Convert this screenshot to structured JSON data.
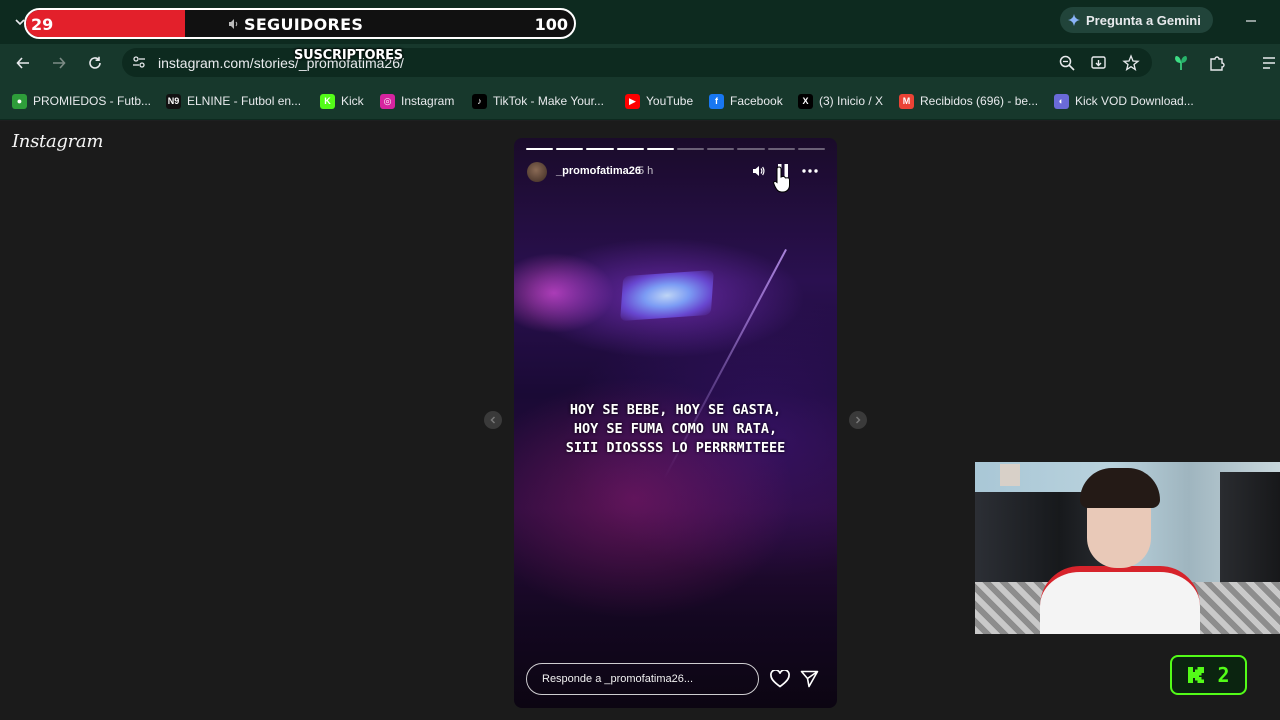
{
  "overlay": {
    "current": "29",
    "label": "SEGUIDORES",
    "target": "100",
    "progress": 0.29,
    "sublabel": "SUSCRIPTORES"
  },
  "browser": {
    "url": "instagram.com/stories/_promofatima26/",
    "gemini_label": "Pregunta a Gemini",
    "bookmarks": [
      {
        "label": "PROMIEDOS - Futb...",
        "icon": "promiedos-icon",
        "color": "#2e9d3a",
        "glyph": "●"
      },
      {
        "label": "ELNINE - Futbol en...",
        "icon": "elnine-icon",
        "color": "#111111",
        "glyph": "N9"
      },
      {
        "label": "Kick",
        "icon": "kick-icon",
        "color": "#53fc18",
        "glyph": "K"
      },
      {
        "label": "Instagram",
        "icon": "instagram-icon",
        "color": "#d6249f",
        "glyph": "◎"
      },
      {
        "label": "TikTok - Make Your...",
        "icon": "tiktok-icon",
        "color": "#000000",
        "glyph": "♪"
      },
      {
        "label": "YouTube",
        "icon": "youtube-icon",
        "color": "#ff0000",
        "glyph": "▶"
      },
      {
        "label": "Facebook",
        "icon": "facebook-icon",
        "color": "#1877f2",
        "glyph": "f"
      },
      {
        "label": "(3) Inicio / X",
        "icon": "x-icon",
        "color": "#000000",
        "glyph": "X"
      },
      {
        "label": "Recibidos (696) - be...",
        "icon": "gmail-icon",
        "color": "#ea4335",
        "glyph": "M"
      },
      {
        "label": "Kick VOD Download...",
        "icon": "kickvod-icon",
        "color": "#6a6ad8",
        "glyph": "◐"
      }
    ]
  },
  "instagram": {
    "logo": "Instagram",
    "story": {
      "username": "_promofatima26",
      "time": "5 h",
      "segments_total": 10,
      "segments_done": 5,
      "caption_lines": [
        "HOY SE BEBE, HOY SE GASTA,",
        "HOY SE FUMA COMO UN RATA,",
        "SIII DIOSSSS LO PERRRMITEEE"
      ],
      "reply_placeholder": "Responde a _promofatima26..."
    }
  },
  "kick_badge": {
    "count": "2",
    "color": "#53fc18"
  }
}
